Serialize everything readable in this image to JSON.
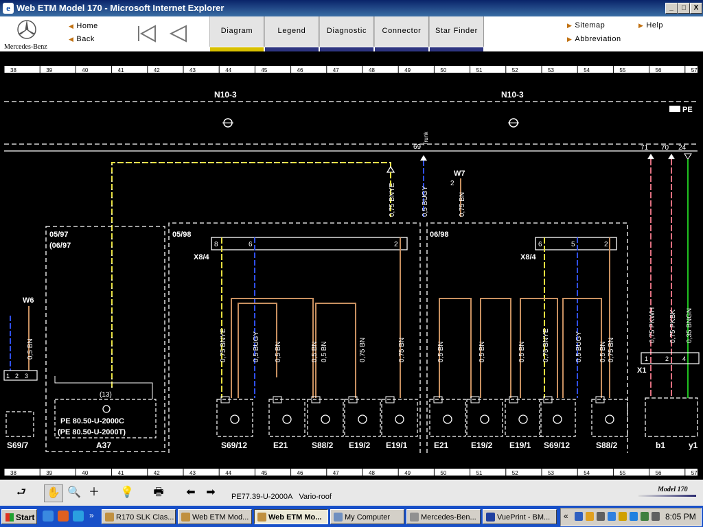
{
  "window": {
    "title": "Web ETM Model 170 - Microsoft Internet Explorer",
    "buttons": [
      "_",
      "□",
      "X"
    ]
  },
  "header": {
    "brand": "Mercedes-Benz",
    "nav_links": {
      "home": "Home",
      "back": "Back"
    },
    "tabs": [
      "Diagram",
      "Legend",
      "Diagnostic",
      "Connector",
      "Star Finder"
    ],
    "active_tab": "Diagram",
    "right_links": {
      "sitemap": "Sitemap",
      "help": "Help",
      "abbreviation": "Abbreviation"
    }
  },
  "diagram": {
    "grid_numbers": [
      "38",
      "39",
      "40",
      "41",
      "42",
      "43",
      "44",
      "45",
      "46",
      "47",
      "48",
      "49",
      "50",
      "51",
      "52",
      "53",
      "54",
      "55",
      "56",
      "57"
    ],
    "modules": [
      "N10-3",
      "N10-3"
    ],
    "pe_label": "PE",
    "sections": {
      "left": {
        "lines": [
          "05/97",
          "(06/97"
        ],
        "component": "A37",
        "pin": "(13)",
        "pe_refs": [
          "PE 80.50-U-2000C",
          "(PE 80.50-U-2000T)"
        ]
      },
      "mid": {
        "title": "05/98",
        "connector": "X8/4",
        "pins": [
          "8",
          "6",
          "2"
        ]
      },
      "right": {
        "title": "06/98",
        "connector": "X8/4",
        "pins": [
          "6",
          "5",
          "2"
        ]
      }
    },
    "top_wires": [
      {
        "label": "0,75 BNYE"
      },
      {
        "label": "0,5 BUGY",
        "pin": "69",
        "note": "Trunk"
      },
      {
        "label": "0,75 BN",
        "connector": "W7",
        "pin": "2"
      }
    ],
    "far_left": {
      "ground": "W6",
      "wire": "0,5 BN",
      "pins": [
        "1",
        "2",
        "3"
      ],
      "component": "S69/7"
    },
    "far_right": {
      "pins": [
        "71",
        "70",
        "24"
      ],
      "wires": [
        "0,75 PKWH",
        "0,75 PKBK",
        "0,35 BNGN"
      ],
      "connector": "X1",
      "conn_pins": [
        "1",
        "2",
        "4"
      ],
      "components": [
        "b1",
        "y1"
      ]
    },
    "wire_labels_mid": [
      "0,75 BNYE",
      "0,5 BUGY",
      "0,5 BN",
      "0,5 BN",
      "0,5 BN",
      "0,75 BN",
      "0,75 BN"
    ],
    "wire_labels_right": [
      "0,5 BN",
      "0,5 BN",
      "0,5 BN",
      "0,75 BNYE",
      "0,5 BUGY",
      "0,5 BN",
      "0,75 BN"
    ],
    "components_mid": [
      "S69/12",
      "E21",
      "S88/2",
      "E19/2",
      "E19/1"
    ],
    "components_right": [
      "E21",
      "E19/2",
      "E19/1",
      "S69/12",
      "S88/2"
    ]
  },
  "statusbar": {
    "doc_id": "PE77.39-U-2000A",
    "doc_title": "Vario-roof",
    "model": "Model 170"
  },
  "taskbar": {
    "start": "Start",
    "tasks": [
      "R170 SLK Clas...",
      "Web ETM Mod...",
      "Web ETM Mo...",
      "My Computer",
      "Mercedes-Ben...",
      "VuePrint - BM..."
    ],
    "active_task": "Web ETM Mo...",
    "time": "8:05 PM"
  }
}
